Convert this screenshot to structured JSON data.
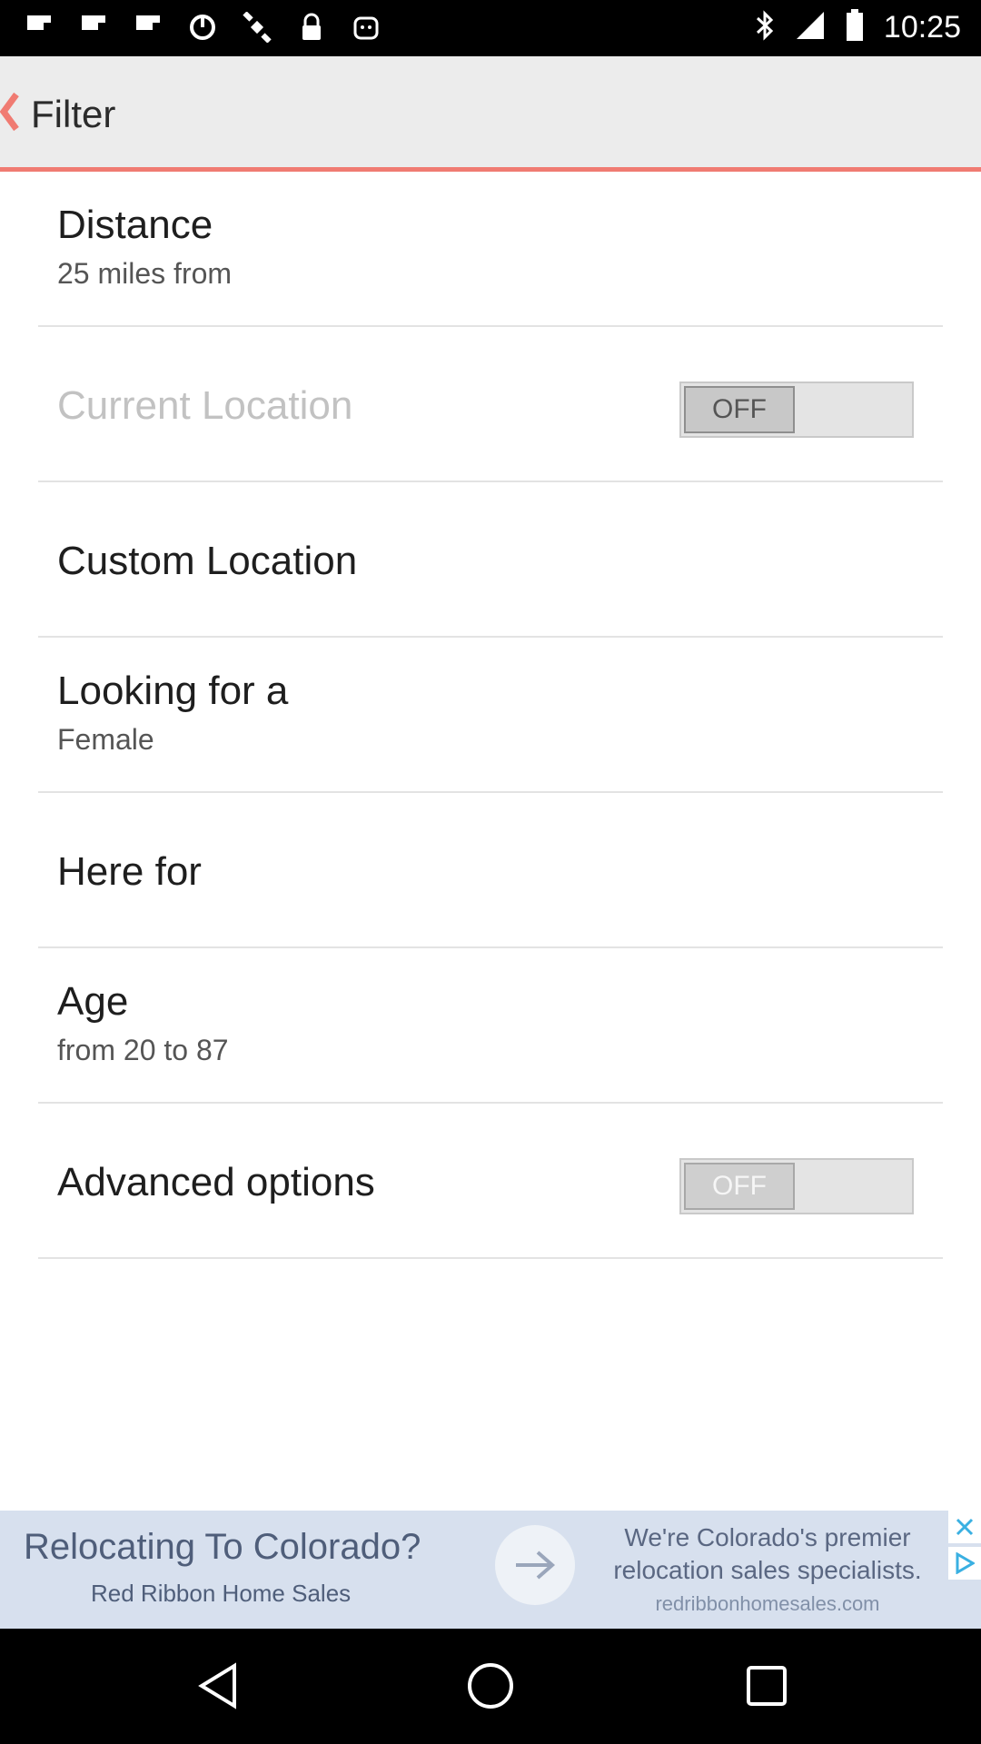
{
  "status_bar": {
    "time": "10:25",
    "left_icons": [
      "flipboard-icon",
      "flipboard-icon",
      "flipboard-icon",
      "data-usage-icon",
      "satellite-icon",
      "lock-icon",
      "android-debug-icon"
    ],
    "right_icons": [
      "bluetooth-icon",
      "signal-icon",
      "battery-icon"
    ]
  },
  "header": {
    "title": "Filter",
    "back_icon": "chevron-left-icon"
  },
  "filters": [
    {
      "title": "Distance",
      "subtitle": "25 miles from"
    },
    {
      "title": "Current Location",
      "toggle": "OFF"
    },
    {
      "title": "Custom Location"
    },
    {
      "title": "Looking for a",
      "subtitle": "Female"
    },
    {
      "title": "Here for"
    },
    {
      "title": "Age",
      "subtitle": "from 20 to 87"
    },
    {
      "title": "Advanced options",
      "toggle": "OFF"
    }
  ],
  "ad": {
    "headline": "Relocating To Colorado?",
    "brand": "Red Ribbon Home Sales",
    "line1": "We're Colorado's premier",
    "line2": "relocation sales specialists.",
    "url": "redribbonhomesales.com"
  },
  "colors": {
    "accent": "#f07b72",
    "appbar_bg": "#ececec",
    "ad_bg": "#d7e0ee"
  }
}
